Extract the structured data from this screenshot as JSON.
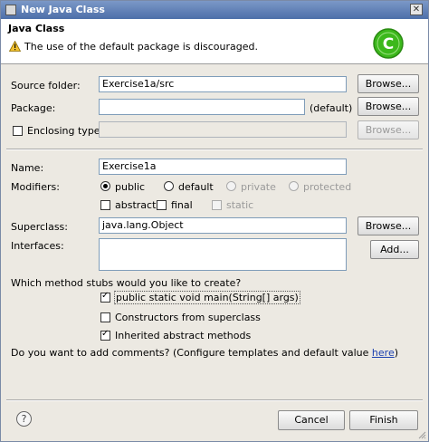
{
  "window": {
    "title": "New Java Class",
    "close_label": "✕"
  },
  "header": {
    "title": "Java Class",
    "message": "The use of the default package is discouraged.",
    "logo_letter": "C"
  },
  "form": {
    "source_folder": {
      "label": "Source folder:",
      "value": "Exercise1a/src",
      "browse": "Browse..."
    },
    "package": {
      "label": "Package:",
      "value": "",
      "suffix": "(default)",
      "browse": "Browse..."
    },
    "enclosing_type": {
      "label": "Enclosing type:",
      "value": "",
      "browse": "Browse..."
    },
    "name": {
      "label": "Name:",
      "value": "Exercise1a"
    },
    "modifiers": {
      "label": "Modifiers:",
      "public": "public",
      "default": "default",
      "private": "private",
      "protected": "protected",
      "abstract": "abstract",
      "final": "final",
      "static": "static"
    },
    "superclass": {
      "label": "Superclass:",
      "value": "java.lang.Object",
      "browse": "Browse..."
    },
    "interfaces": {
      "label": "Interfaces:",
      "add": "Add..."
    }
  },
  "stubs": {
    "question": "Which method stubs would you like to create?",
    "main": "public static void main(String[] args)",
    "constructors": "Constructors from superclass",
    "inherited": "Inherited abstract methods"
  },
  "comments": {
    "question": "Do you want to add comments? (Configure templates and default value ",
    "link": "here",
    "close": ")"
  },
  "footer": {
    "cancel": "Cancel",
    "finish": "Finish",
    "help": "?"
  },
  "colors": {
    "titlebar": "#4d6fa9",
    "logo": "#3cb81c",
    "link": "#1a3fb0"
  }
}
